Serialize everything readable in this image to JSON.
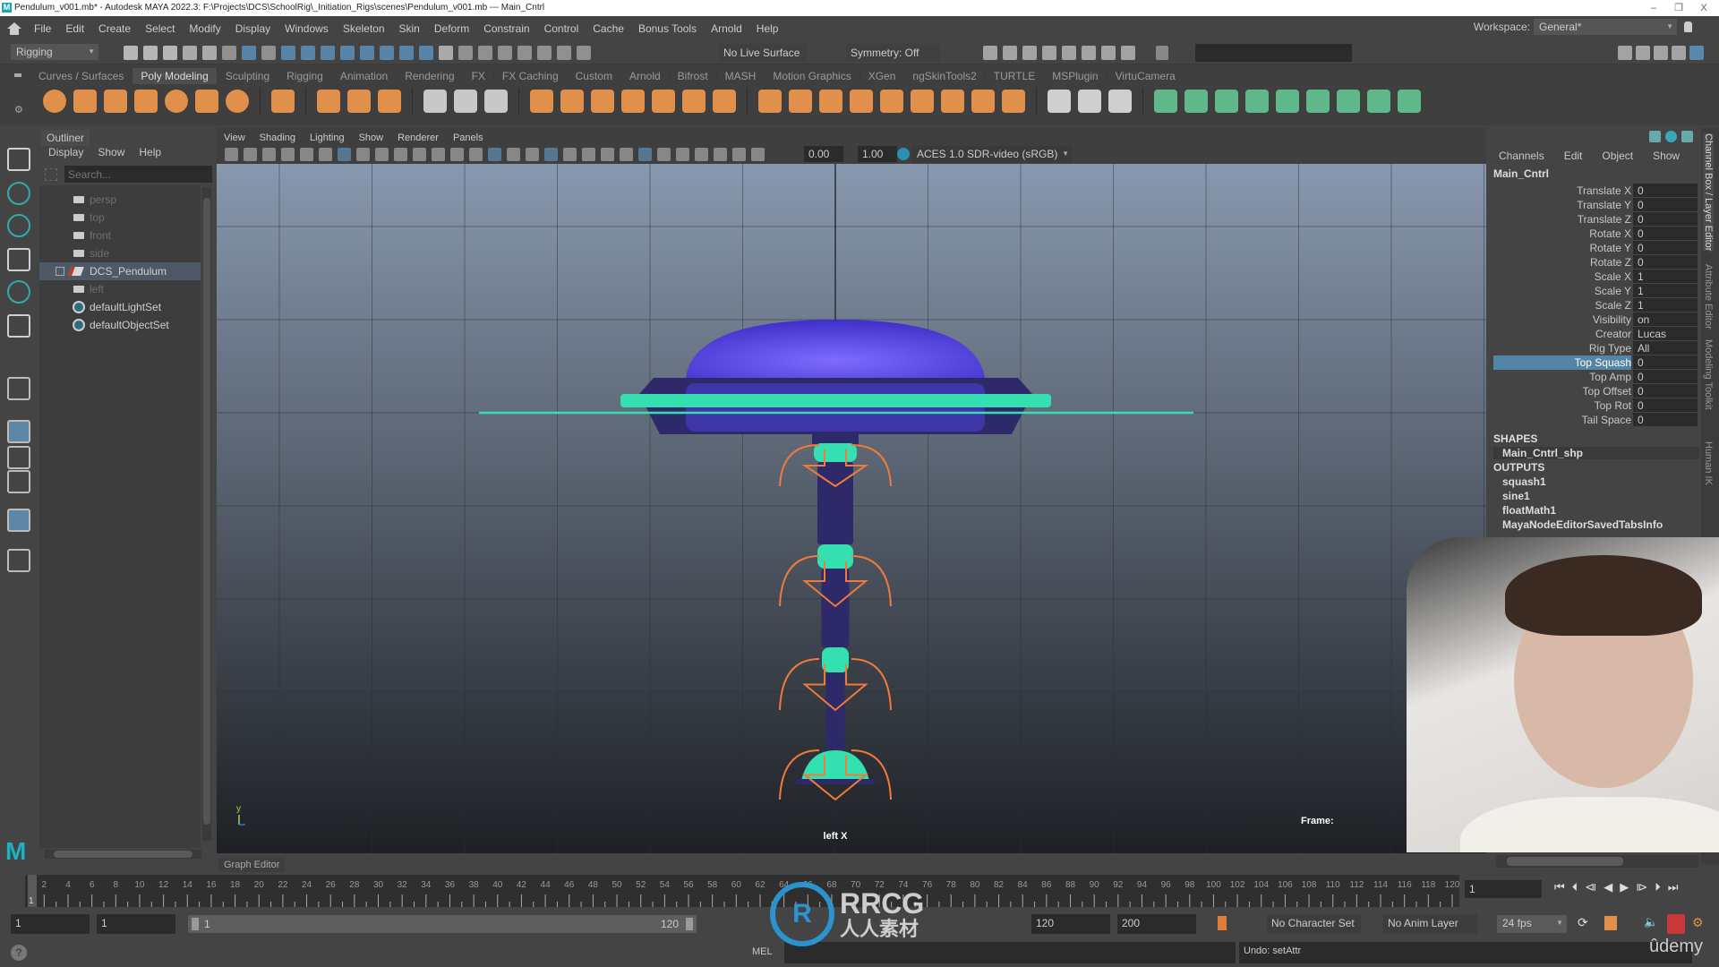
{
  "titlebar": {
    "title": "Pendulum_v001.mb* - Autodesk MAYA 2022.3: F:\\Projects\\DCS\\SchoolRig\\_Initiation_Rigs\\scenes\\Pendulum_v001.mb  ---  Main_Cntrl",
    "app_icon": "M",
    "minimize": "–",
    "restore": "❐",
    "close": "X"
  },
  "menubar": {
    "items": [
      "File",
      "Edit",
      "Create",
      "Select",
      "Modify",
      "Display",
      "Windows",
      "Skeleton",
      "Skin",
      "Deform",
      "Constrain",
      "Control",
      "Cache",
      "Bonus Tools",
      "Arnold",
      "Help"
    ],
    "workspace_label": "Workspace:",
    "workspace_value": "General*"
  },
  "statusline": {
    "menuset": "Rigging",
    "live_surface": "No Live Surface",
    "symmetry": "Symmetry: Off",
    "search_value": ""
  },
  "shelf": {
    "tabs": [
      "Curves / Surfaces",
      "Poly Modeling",
      "Sculpting",
      "Rigging",
      "Animation",
      "Rendering",
      "FX",
      "FX Caching",
      "Custom",
      "Arnold",
      "Bifrost",
      "MASH",
      "Motion Graphics",
      "XGen",
      "ngSkinTools2",
      "TURTLE",
      "MSPlugin",
      "VirtuCamera"
    ],
    "active_tab": "Poly Modeling",
    "groups": [
      {
        "color": "#e0904a",
        "icons": [
          "poly-sphere-icon",
          "poly-cube-icon",
          "poly-cylinder-icon",
          "poly-cone-icon",
          "poly-torus-icon",
          "poly-plane-icon",
          "poly-disc-icon"
        ]
      },
      {
        "color": "#e0904a",
        "icons": [
          "platonic-solid-icon"
        ]
      },
      {
        "color": "#e0904a",
        "icons": [
          "super-shape-icon",
          "type-icon",
          "svg-icon"
        ]
      },
      {
        "color": "#c8c8c8",
        "icons": [
          "center-pivot-icon",
          "freeze-transforms-icon",
          "reset-transform-icon"
        ]
      },
      {
        "color": "#e0904a",
        "icons": [
          "combine-icon",
          "separate-icon",
          "mirror-icon",
          "smooth-icon",
          "extract-icon",
          "remesh-icon",
          "retopo-icon"
        ]
      },
      {
        "color": "#e0904a",
        "icons": [
          "extrude-icon",
          "bridge-icon",
          "bevel-icon",
          "bool-icon",
          "append-icon",
          "fill-hole-icon",
          "collapse-icon",
          "merge-icon",
          "wedge-icon"
        ]
      },
      {
        "color": "#cfcfcf",
        "icons": [
          "multi-cut-icon",
          "insert-edge-loop-icon",
          "offset-edge-icon"
        ]
      },
      {
        "color": "#5fb88a",
        "icons": [
          "planar-map-icon",
          "cylindrical-map-icon",
          "spherical-map-icon",
          "auto-map-icon",
          "unfold-icon",
          "uv-editor-icon",
          "sew-icon",
          "cut-uv-icon",
          "magnet-icon"
        ]
      }
    ]
  },
  "toolbox": {
    "tools": [
      "select-tool-icon",
      "lasso-tool-icon",
      "paint-select-icon",
      "move-tool-icon",
      "rotate-tool-icon",
      "scale-tool-icon",
      "soft-select-icon",
      "single-perspective-layout-icon",
      "four-view-layout-icon",
      "persp-outliner-layout-icon",
      "outliner-layout-icon",
      "search-icon"
    ],
    "logo": "M"
  },
  "outliner": {
    "tab": "Outliner",
    "menus": [
      "Display",
      "Show",
      "Help"
    ],
    "search_placeholder": "Search...",
    "items": [
      {
        "label": "persp",
        "type": "camera",
        "dimmed": true
      },
      {
        "label": "top",
        "type": "camera",
        "dimmed": true
      },
      {
        "label": "front",
        "type": "camera",
        "dimmed": true
      },
      {
        "label": "side",
        "type": "camera",
        "dimmed": true
      },
      {
        "label": "DCS_Pendulum",
        "type": "group",
        "selected": true
      },
      {
        "label": "left",
        "type": "camera",
        "dimmed": true
      },
      {
        "label": "defaultLightSet",
        "type": "set"
      },
      {
        "label": "defaultObjectSet",
        "type": "set"
      }
    ]
  },
  "viewport": {
    "menus": [
      "View",
      "Shading",
      "Lighting",
      "Show",
      "Renderer",
      "Panels"
    ],
    "exposure": "0.00",
    "gamma": "1.00",
    "color_space": "ACES 1.0 SDR-video (sRGB)",
    "camera_label": "left X",
    "frame_label": "Frame:",
    "axis_label": "y",
    "colors": {
      "dome": "#6a55f0",
      "disc": "#2e2a6a",
      "ring": "#35e0b0",
      "control": "#f07a3a",
      "bg_top": "#8898ae",
      "bg_bottom": "#1e2024"
    }
  },
  "channelbox": {
    "menus": [
      "Channels",
      "Edit",
      "Object",
      "Show"
    ],
    "node": "Main_Cntrl",
    "channels": [
      {
        "label": "Translate X",
        "value": "0"
      },
      {
        "label": "Translate Y",
        "value": "0"
      },
      {
        "label": "Translate Z",
        "value": "0"
      },
      {
        "label": "Rotate X",
        "value": "0"
      },
      {
        "label": "Rotate Y",
        "value": "0"
      },
      {
        "label": "Rotate Z",
        "value": "0"
      },
      {
        "label": "Scale X",
        "value": "1"
      },
      {
        "label": "Scale Y",
        "value": "1"
      },
      {
        "label": "Scale Z",
        "value": "1"
      },
      {
        "label": "Visibility",
        "value": "on"
      },
      {
        "label": "Creator",
        "value": "Lucas Ridley"
      },
      {
        "label": "Rig Type",
        "value": "All"
      },
      {
        "label": "Top Squash",
        "value": "0",
        "selected": true
      },
      {
        "label": "Top Amp",
        "value": "0"
      },
      {
        "label": "Top Offset",
        "value": "0"
      },
      {
        "label": "Top Rot",
        "value": "0"
      },
      {
        "label": "Tail Space",
        "value": "0"
      }
    ],
    "shapes_header": "SHAPES",
    "shapes": [
      "Main_Cntrl_shp"
    ],
    "outputs_header": "OUTPUTS",
    "outputs": [
      "squash1",
      "sine1",
      "floatMath1",
      "MayaNodeEditorSavedTabsInfo"
    ]
  },
  "sidetabs": [
    "Channel Box / Layer Editor",
    "Attribute Editor",
    "Modeling Toolkit",
    "Human IK"
  ],
  "graph_editor_tab": "Graph Editor",
  "timeline": {
    "start": 1,
    "end": 120,
    "current_frame": "1",
    "current_frame_field": "1"
  },
  "range": {
    "anim_start": "1",
    "play_start": "1",
    "slider_start": "1",
    "slider_end": "120",
    "play_end": "120",
    "anim_end": "200",
    "character_set": "No Character Set",
    "anim_layer": "No Anim Layer",
    "fps": "24 fps"
  },
  "commandline": {
    "lang": "MEL",
    "command": "",
    "result": "Undo: setAttr",
    "help": "?"
  },
  "watermarks": {
    "rrcg": "RRCG",
    "rrcg_cn": "人人素材",
    "udemy": "ûdemy"
  }
}
